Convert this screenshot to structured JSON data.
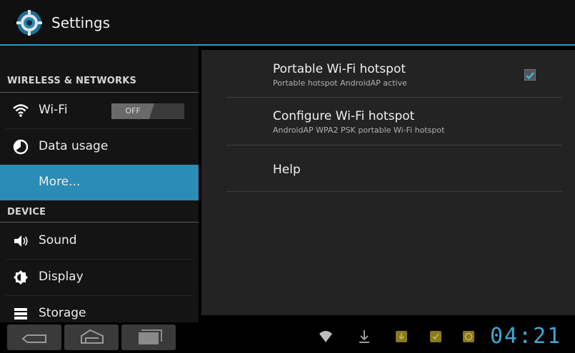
{
  "colors": {
    "accent": "#2c9bc2",
    "selected": "#2b8cb5",
    "clock": "#3fa8d6"
  },
  "action_bar": {
    "title": "Settings",
    "icon": "settings-gear-icon"
  },
  "sidebar": {
    "section_wireless": "WIRELESS & NETWORKS",
    "section_device": "DEVICE",
    "items": [
      {
        "label": "Wi-Fi",
        "icon": "wifi-icon",
        "toggle": "OFF"
      },
      {
        "label": "Data usage",
        "icon": "data-usage-icon"
      },
      {
        "label": "More...",
        "selected": true
      },
      {
        "label": "Sound",
        "icon": "speaker-icon"
      },
      {
        "label": "Display",
        "icon": "brightness-icon"
      },
      {
        "label": "Storage",
        "icon": "storage-icon"
      }
    ]
  },
  "panel": {
    "items": [
      {
        "title": "Portable Wi-Fi hotspot",
        "summary": "Portable hotspot AndroidAP active",
        "checked": true
      },
      {
        "title": "Configure Wi-Fi hotspot",
        "summary": "AndroidAP WPA2 PSK portable Wi-Fi hotspot"
      },
      {
        "title": "Help"
      }
    ]
  },
  "nav": {
    "back": "back-icon",
    "home": "home-icon",
    "recents": "recents-icon"
  },
  "status": {
    "time": "04:21",
    "icons": [
      "wifi-icon",
      "download-icon",
      "notification-icon",
      "checked-notification-icon",
      "sync-icon"
    ]
  }
}
